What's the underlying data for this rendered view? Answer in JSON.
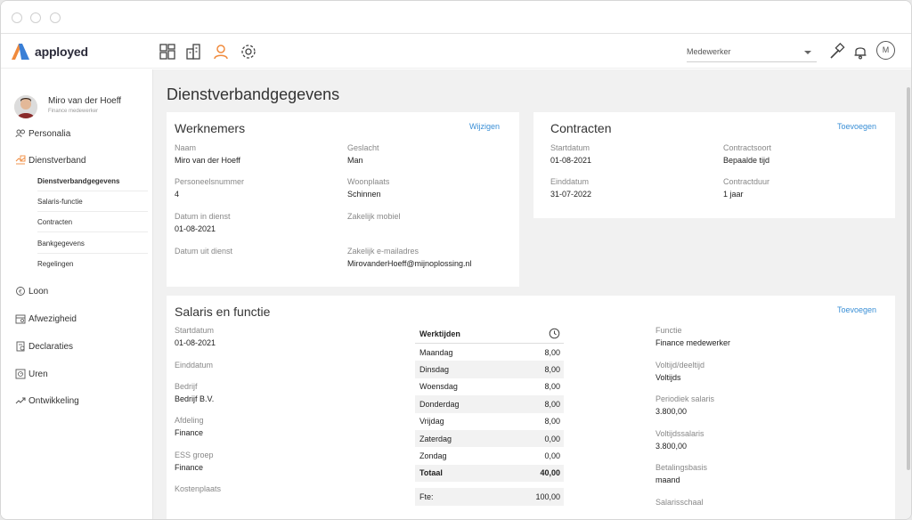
{
  "app": {
    "brand": "apployed",
    "role_select": "Medewerker",
    "user_initial": "M"
  },
  "user": {
    "name": "Miro van der Hoeff",
    "role": "Finance medewerker"
  },
  "nav": {
    "personalia": "Personalia",
    "dienstverband": "Dienstverband",
    "sub": [
      "Dienstverbandgegevens",
      "Salaris-functie",
      "Contracten",
      "Bankgegevens",
      "Regelingen"
    ],
    "loon": "Loon",
    "afwezigheid": "Afwezigheid",
    "declaraties": "Declaraties",
    "uren": "Uren",
    "ontwikkeling": "Ontwikkeling"
  },
  "page_title": "Dienstverbandgegevens",
  "werknemers": {
    "title": "Werknemers",
    "action": "Wijzigen",
    "fields": {
      "naam_label": "Naam",
      "naam": "Miro van der Hoeff",
      "geslacht_label": "Geslacht",
      "geslacht": "Man",
      "personeelsnummer_label": "Personeelsnummer",
      "personeelsnummer": "4",
      "woonplaats_label": "Woonplaats",
      "woonplaats": "Schinnen",
      "datum_in_label": "Datum in dienst",
      "datum_in": "01-08-2021",
      "zakelijk_mobiel_label": "Zakelijk mobiel",
      "datum_uit_label": "Datum uit dienst",
      "email_label": "Zakelijk e-mailadres",
      "email": "MirovanderHoeff@mijnoplossing.nl"
    }
  },
  "contracten": {
    "title": "Contracten",
    "action": "Toevoegen",
    "fields": {
      "startdatum_label": "Startdatum",
      "startdatum": "01-08-2021",
      "contractsoort_label": "Contractsoort",
      "contractsoort": "Bepaalde tijd",
      "einddatum_label": "Einddatum",
      "einddatum": "31-07-2022",
      "contractduur_label": "Contractduur",
      "contractduur": "1 jaar"
    }
  },
  "salaris": {
    "title": "Salaris en functie",
    "action": "Toevoegen",
    "left": {
      "startdatum_label": "Startdatum",
      "startdatum": "01-08-2021",
      "einddatum_label": "Einddatum",
      "bedrijf_label": "Bedrijf",
      "bedrijf": "Bedrijf B.V.",
      "afdeling_label": "Afdeling",
      "afdeling": "Finance",
      "ess_label": "ESS groep",
      "ess": "Finance",
      "kostenplaats_label": "Kostenplaats"
    },
    "werktijden": {
      "title": "Werktijden",
      "rows": [
        {
          "day": "Maandag",
          "hours": "8,00"
        },
        {
          "day": "Dinsdag",
          "hours": "8,00"
        },
        {
          "day": "Woensdag",
          "hours": "8,00"
        },
        {
          "day": "Donderdag",
          "hours": "8,00"
        },
        {
          "day": "Vrijdag",
          "hours": "8,00"
        },
        {
          "day": "Zaterdag",
          "hours": "0,00"
        },
        {
          "day": "Zondag",
          "hours": "0,00"
        }
      ],
      "total_label": "Totaal",
      "total": "40,00",
      "fte_label": "Fte:",
      "fte": "100,00"
    },
    "right": {
      "functie_label": "Functie",
      "functie": "Finance medewerker",
      "voltijd_label": "Voltijd/deeltijd",
      "voltijd": "Voltijds",
      "periodiek_label": "Periodiek salaris",
      "periodiek": "3.800,00",
      "voltijdssalaris_label": "Voltijdssalaris",
      "voltijdssalaris": "3.800,00",
      "betalingsbasis_label": "Betalingsbasis",
      "betalingsbasis": "maand",
      "salarisschaal_label": "Salarisschaal"
    }
  },
  "colors": {
    "accent": "#3a8fd6",
    "brand_orange": "#f08a3c",
    "brand_blue": "#3a7fd6"
  }
}
